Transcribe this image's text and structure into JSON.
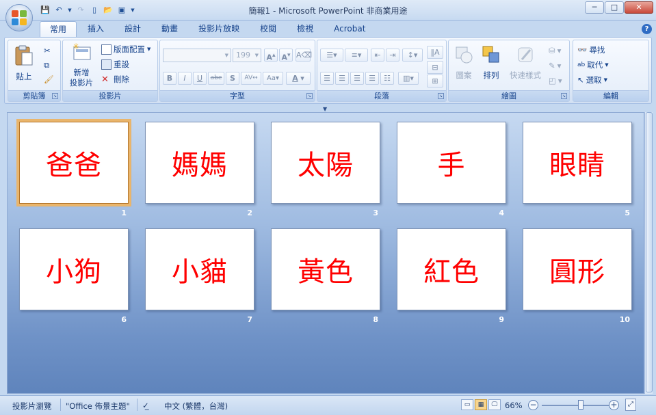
{
  "window": {
    "title": "簡報1 - Microsoft PowerPoint 非商業用途",
    "minimize": "─",
    "maximize": "□",
    "close": "✕"
  },
  "tabs": [
    "常用",
    "插入",
    "設計",
    "動畫",
    "投影片放映",
    "校閱",
    "檢視",
    "Acrobat"
  ],
  "ribbon": {
    "clipboard": {
      "label": "剪貼簿",
      "paste": "貼上"
    },
    "slides": {
      "label": "投影片",
      "new_slide_1": "新增",
      "new_slide_2": "投影片",
      "layout": "版面配置",
      "reset": "重設",
      "delete": "刪除"
    },
    "font": {
      "label": "字型",
      "size": "199"
    },
    "paragraph": {
      "label": "段落"
    },
    "drawing": {
      "label": "繪圖",
      "shapes": "圖案",
      "arrange": "排列",
      "quick_styles": "快速樣式"
    },
    "editing": {
      "label": "編輯",
      "find": "尋找",
      "replace": "取代",
      "select": "選取"
    }
  },
  "slides": [
    {
      "num": "1",
      "text": "爸爸"
    },
    {
      "num": "2",
      "text": "媽媽"
    },
    {
      "num": "3",
      "text": "太陽"
    },
    {
      "num": "4",
      "text": "手"
    },
    {
      "num": "5",
      "text": "眼睛"
    },
    {
      "num": "6",
      "text": "小狗"
    },
    {
      "num": "7",
      "text": "小貓"
    },
    {
      "num": "8",
      "text": "黃色"
    },
    {
      "num": "9",
      "text": "紅色"
    },
    {
      "num": "10",
      "text": "圓形"
    }
  ],
  "status": {
    "view": "投影片瀏覽",
    "theme": "\"Office 佈景主題\"",
    "language": "中文 (繁體，台灣)",
    "zoom": "66%"
  },
  "colors": {
    "slide_text": "#ff0000",
    "selected_outline": "#e9b56c"
  }
}
